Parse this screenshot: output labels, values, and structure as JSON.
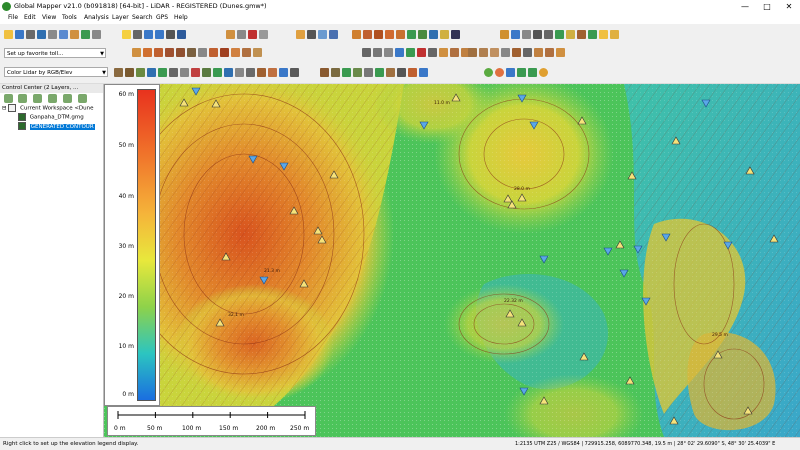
{
  "app": {
    "title": "Global Mapper v21.0 (b091818) [64-bit] - LiDAR - REGISTERED (Dunes.gmw*)"
  },
  "menu": [
    "File",
    "Edit",
    "View",
    "Tools",
    "Analysis",
    "Layer",
    "Search",
    "GPS",
    "Help"
  ],
  "toolbars": {
    "favorite_tools": "Set up favorite toll...",
    "shader": "Color Lidar by RGB/Elev"
  },
  "control_center": {
    "header": "Control Center (2 Layers, ...",
    "workspace": "Current Workspace <Dune",
    "layers": [
      {
        "label": "Ganpaha_DTM.gmg",
        "checked": true,
        "selected": false
      },
      {
        "label": "GENERATED CONTOUR",
        "checked": true,
        "selected": true
      }
    ]
  },
  "elevation_legend": {
    "labels": [
      "60 m",
      "50 m",
      "40 m",
      "30 m",
      "20 m",
      "10 m",
      "0 m"
    ]
  },
  "scale_bar": {
    "labels": [
      "0 m",
      "50 m",
      "100 m",
      "150 m",
      "200 m",
      "250 m"
    ]
  },
  "status": {
    "hint": "Right click to set up the elevation legend display.",
    "readout": "1:2135  UTM Z25 / WGS84 | 729915.258, 6089770.348, 19.5 m | 28° 02' 29.6090\" S, 48° 30' 25.4039\" E"
  },
  "colors": {
    "accent": "#1e63b4",
    "selected": "#0078d7"
  }
}
